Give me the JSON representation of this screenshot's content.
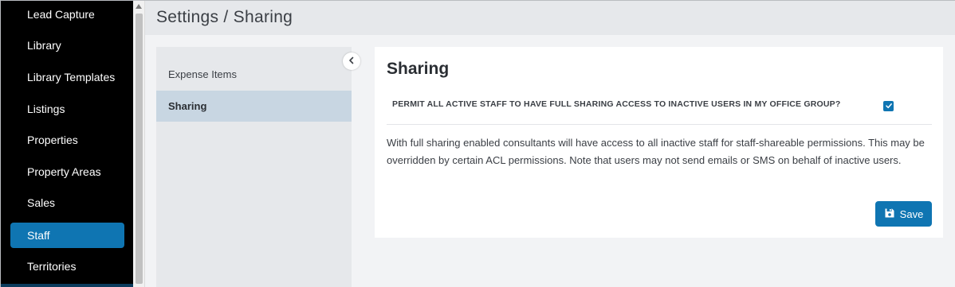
{
  "nav": {
    "items": [
      {
        "label": "Lead Capture",
        "active": false
      },
      {
        "label": "Library",
        "active": false
      },
      {
        "label": "Library Templates",
        "active": false
      },
      {
        "label": "Listings",
        "active": false
      },
      {
        "label": "Properties",
        "active": false
      },
      {
        "label": "Property Areas",
        "active": false
      },
      {
        "label": "Sales",
        "active": false
      },
      {
        "label": "Staff",
        "active": true
      },
      {
        "label": "Territories",
        "active": false
      }
    ]
  },
  "header": {
    "title": "Settings / Sharing"
  },
  "submenu": {
    "items": [
      {
        "label": "Expense Items",
        "active": false
      },
      {
        "label": "Sharing",
        "active": true
      }
    ]
  },
  "card": {
    "title": "Sharing",
    "permission_label": "PERMIT ALL ACTIVE STAFF TO HAVE FULL SHARING ACCESS TO INACTIVE USERS IN MY OFFICE GROUP?",
    "permission_checked": true,
    "description": "With full sharing enabled consultants will have access to all inactive staff for staff-shareable permissions. This may be overridden by certain ACL permissions. Note that users may not send emails or SMS on behalf of inactive users.",
    "save_label": "Save"
  },
  "colors": {
    "accent": "#0f75b2",
    "nav_bg": "#000000",
    "submenu_active": "#c8d6e2"
  },
  "icons": {
    "collapse": "chevron-left-icon",
    "save": "floppy-disk-icon",
    "check": "checkmark-icon"
  }
}
